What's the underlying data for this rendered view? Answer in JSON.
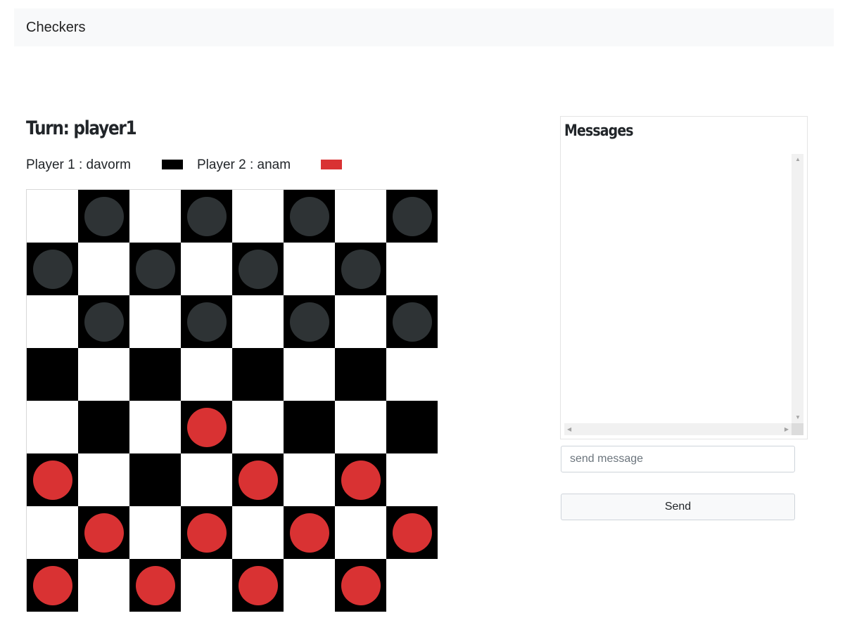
{
  "navbar": {
    "brand": "Checkers"
  },
  "game": {
    "turn_text": "Turn: player1",
    "player1": {
      "label": "Player 1 : davorm",
      "color": "#000000"
    },
    "player2": {
      "label": "Player 2 : anam",
      "color": "#d93233"
    },
    "board": {
      "size": 8,
      "dark_square_color": "#000000",
      "light_square_color": "#ffffff",
      "piece_colors": {
        "b": "#2e3335",
        "r": "#d93233"
      },
      "rows": [
        ".b.b.b.b",
        "b.b.b.b.",
        ".b.b.b.b",
        "........",
        "...r....",
        "r...r.r.",
        ".r.r.r.r",
        "r.r.r.r."
      ]
    }
  },
  "chat": {
    "title": "Messages",
    "messages": [],
    "input_placeholder": "send message",
    "send_label": "Send",
    "scroll_arrows": {
      "up": "▲",
      "down": "▼",
      "left": "◀",
      "right": "▶"
    }
  }
}
